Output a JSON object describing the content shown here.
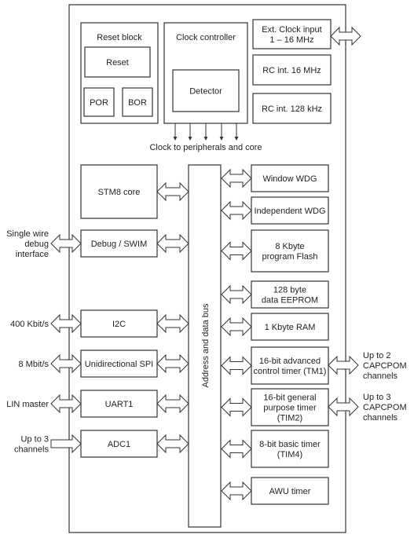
{
  "blocks": {
    "reset_block": {
      "lines": [
        "Reset block"
      ]
    },
    "reset": {
      "lines": [
        "Reset"
      ]
    },
    "por": {
      "lines": [
        "POR"
      ]
    },
    "bor": {
      "lines": [
        "BOR"
      ]
    },
    "clock_controller": {
      "lines": [
        "Clock controller"
      ]
    },
    "detector": {
      "lines": [
        "Detector"
      ]
    },
    "ext_clock": {
      "lines": [
        "Ext. Clock input",
        "1 – 16 MHz"
      ]
    },
    "rc16": {
      "lines": [
        "RC int. 16 MHz"
      ]
    },
    "rc128": {
      "lines": [
        "RC int. 128 kHz"
      ]
    },
    "stm8_core": {
      "lines": [
        "STM8 core"
      ]
    },
    "debug_swim": {
      "lines": [
        "Debug / SWIM"
      ]
    },
    "i2c": {
      "lines": [
        "I2C"
      ]
    },
    "spi": {
      "lines": [
        "Unidirectional SPI"
      ]
    },
    "uart1": {
      "lines": [
        "UART1"
      ]
    },
    "adc1": {
      "lines": [
        "ADC1"
      ]
    },
    "window_wdg": {
      "lines": [
        "Window WDG"
      ]
    },
    "independent_wdg": {
      "lines": [
        "Independent WDG"
      ]
    },
    "flash": {
      "lines": [
        "8 Kbyte",
        "program Flash"
      ]
    },
    "eeprom": {
      "lines": [
        "128 byte",
        "data EEPROM"
      ]
    },
    "ram": {
      "lines": [
        "1 Kbyte RAM"
      ]
    },
    "tim1": {
      "lines": [
        "16-bit advanced",
        "control timer (TM1)"
      ]
    },
    "tim2": {
      "lines": [
        "16-bit general",
        "purpose timer",
        "(TIM2)"
      ]
    },
    "tim4": {
      "lines": [
        "8-bit basic timer",
        "(TIM4)"
      ]
    },
    "awu": {
      "lines": [
        "AWU timer"
      ]
    }
  },
  "bus_label": "Address and data bus",
  "clock_output_label": "Clock to peripherals and core",
  "external_labels": {
    "swim": [
      "Single wire",
      "debug",
      "interface"
    ],
    "i2c": [
      "400 Kbit/s"
    ],
    "spi": [
      "8 Mbit/s"
    ],
    "uart": [
      "LIN master"
    ],
    "adc": [
      "Up to 3",
      "channels"
    ],
    "tim1": [
      "Up to 2",
      "CAPCPOM",
      "channels"
    ],
    "tim2": [
      "Up to 3",
      "CAPCPOM",
      "channels"
    ]
  }
}
